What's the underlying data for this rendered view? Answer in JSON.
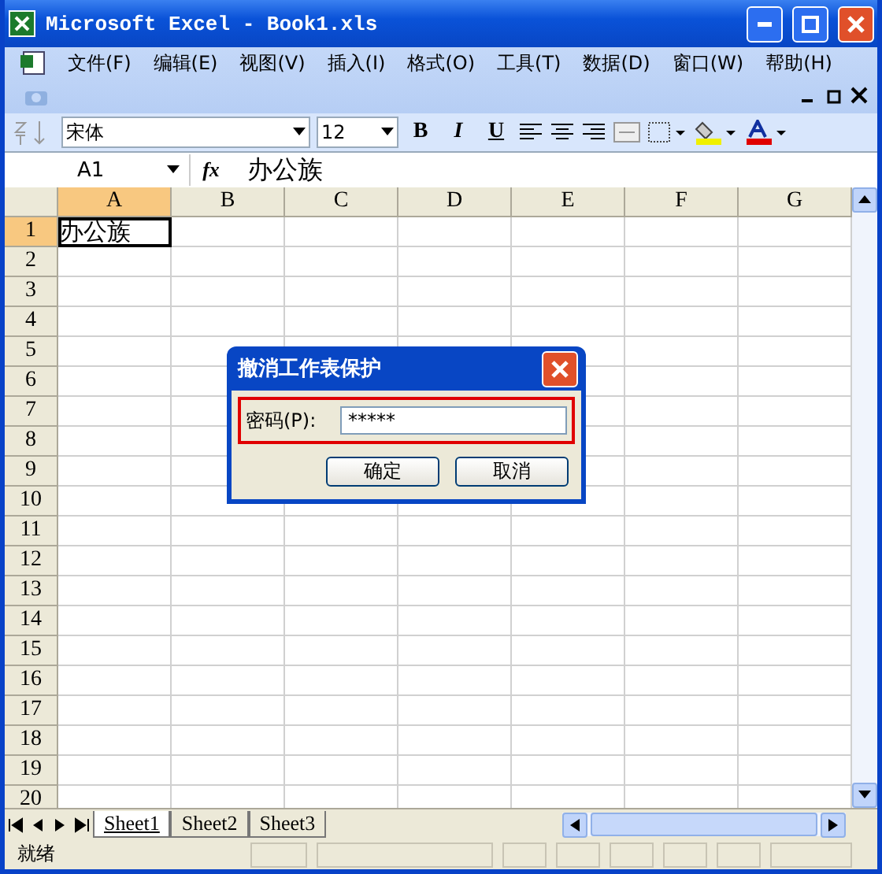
{
  "window": {
    "title": "Microsoft Excel - Book1.xls"
  },
  "menu": [
    "文件(F)",
    "编辑(E)",
    "视图(V)",
    "插入(I)",
    "格式(O)",
    "工具(T)",
    "数据(D)",
    "窗口(W)",
    "帮助(H)"
  ],
  "toolbar": {
    "font": "宋体",
    "size": "12",
    "styles": [
      {
        "label": "B",
        "kind": "bold"
      },
      {
        "label": "I",
        "kind": "italic"
      },
      {
        "label": "U",
        "kind": "underline"
      }
    ]
  },
  "formula_bar": {
    "name_box": "A1",
    "fx": "fx",
    "content": "办公族"
  },
  "columns": [
    {
      "label": "A",
      "selected": true
    },
    {
      "label": "B",
      "selected": false
    },
    {
      "label": "C",
      "selected": false
    },
    {
      "label": "D",
      "selected": false
    },
    {
      "label": "E",
      "selected": false
    },
    {
      "label": "F",
      "selected": false
    },
    {
      "label": "G",
      "selected": false
    }
  ],
  "rows": [
    {
      "label": "1",
      "selected": true,
      "cells": [
        {
          "value": "办公族",
          "selected": true
        }
      ]
    },
    {
      "label": "2",
      "selected": false
    },
    {
      "label": "3",
      "selected": false
    },
    {
      "label": "4",
      "selected": false
    },
    {
      "label": "5",
      "selected": false
    },
    {
      "label": "6",
      "selected": false
    },
    {
      "label": "7",
      "selected": false
    },
    {
      "label": "8",
      "selected": false
    },
    {
      "label": "9",
      "selected": false
    },
    {
      "label": "10",
      "selected": false
    },
    {
      "label": "11",
      "selected": false
    },
    {
      "label": "12",
      "selected": false
    },
    {
      "label": "13",
      "selected": false
    },
    {
      "label": "14",
      "selected": false
    },
    {
      "label": "15",
      "selected": false
    },
    {
      "label": "16",
      "selected": false
    },
    {
      "label": "17",
      "selected": false
    },
    {
      "label": "18",
      "selected": false
    },
    {
      "label": "19",
      "selected": false
    },
    {
      "label": "20",
      "selected": false
    }
  ],
  "sheets": [
    {
      "label": "Sheet1",
      "selected": true
    },
    {
      "label": "Sheet2",
      "selected": false
    },
    {
      "label": "Sheet3",
      "selected": false
    }
  ],
  "status_bar": {
    "text": "就绪"
  },
  "dialog": {
    "title": "撤消工作表保护",
    "label": "密码(P):",
    "value": "*****",
    "buttons": [
      "确定",
      "取消"
    ]
  }
}
